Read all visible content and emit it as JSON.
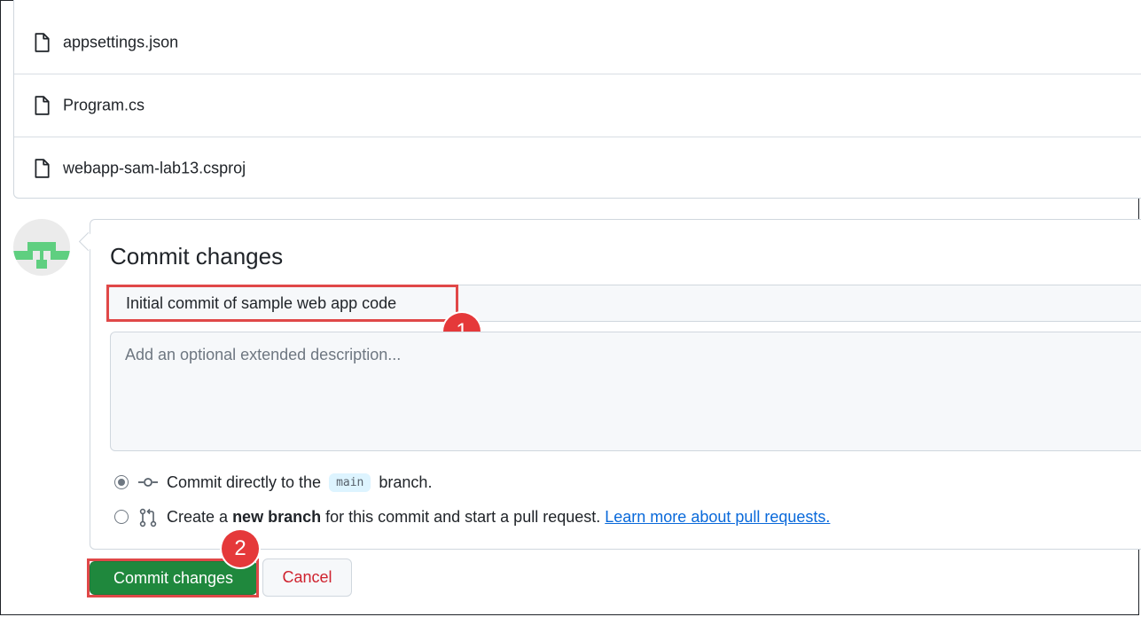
{
  "files": [
    {
      "name": "appsettings.json",
      "icon": "file-icon"
    },
    {
      "name": "Program.cs",
      "icon": "file-icon"
    },
    {
      "name": "webapp-sam-lab13.csproj",
      "icon": "file-icon"
    }
  ],
  "commit": {
    "title": "Commit changes",
    "summary_value": "Initial commit of sample web app code",
    "description_placeholder": "Add an optional extended description...",
    "option_direct": {
      "prefix": "Commit directly to the",
      "branch": "main",
      "suffix": "branch.",
      "icon": "git-commit-icon",
      "checked": true
    },
    "option_new_branch": {
      "prefix": "Create a",
      "bold": "new branch",
      "middle": "for this commit and start a pull request.",
      "link": "Learn more about pull requests.",
      "icon": "git-pull-request-icon",
      "checked": false
    },
    "commit_button": "Commit changes",
    "cancel_button": "Cancel"
  },
  "annotations": {
    "badge_1": "1",
    "badge_2": "2",
    "highlight_color": "#e04848"
  },
  "colors": {
    "primary_button": "#1f883d",
    "cancel_text": "#cf222e",
    "link": "#0969da",
    "avatar_green": "#5fcf80"
  }
}
